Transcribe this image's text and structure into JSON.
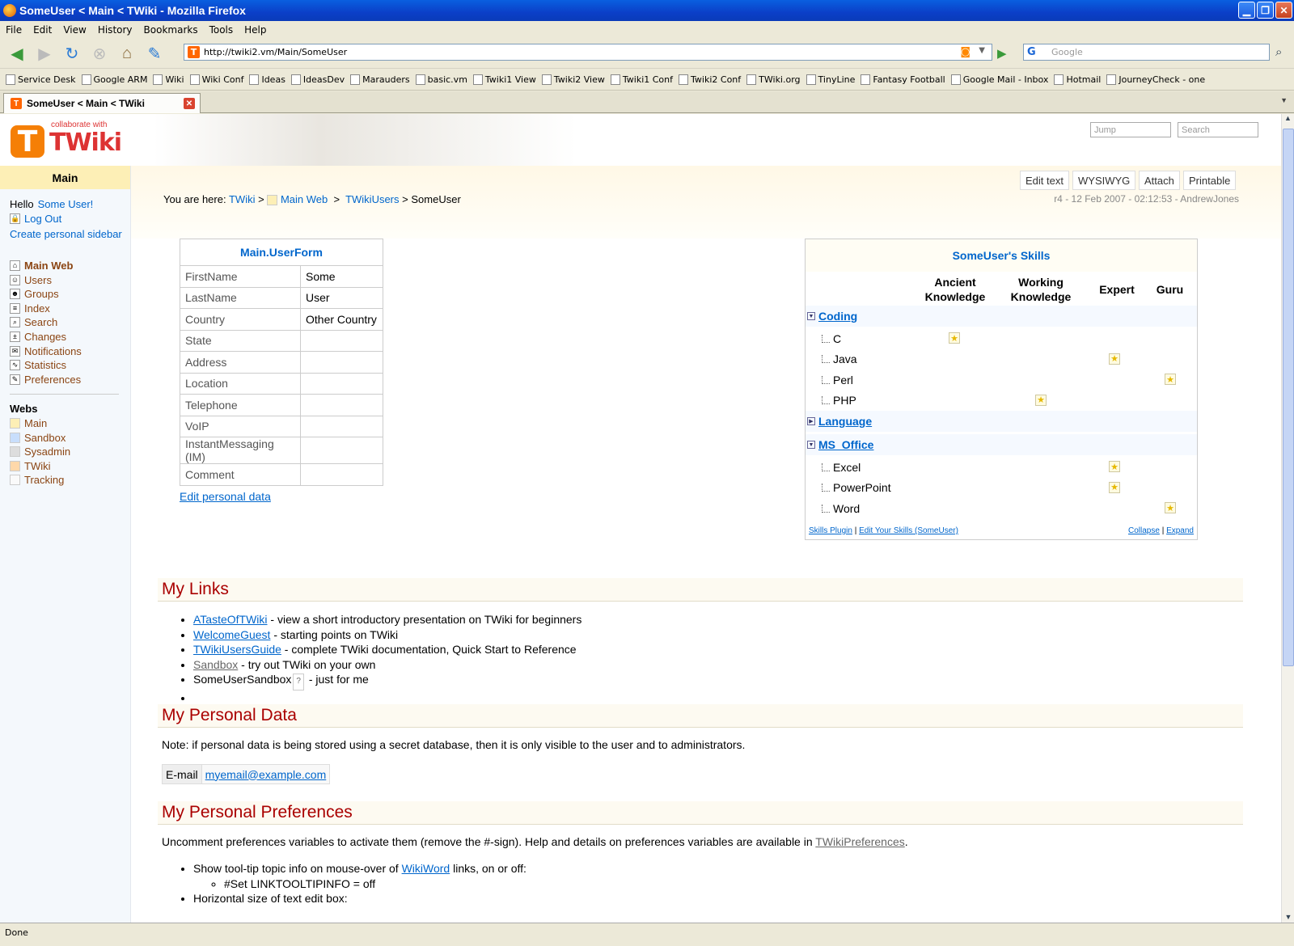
{
  "window": {
    "title": "SomeUser < Main < TWiki - Mozilla Firefox"
  },
  "menu": [
    "File",
    "Edit",
    "View",
    "History",
    "Bookmarks",
    "Tools",
    "Help"
  ],
  "nav": {
    "url": "http://twiki2.vm/Main/SomeUser",
    "search_placeholder": "Google"
  },
  "bookmarks": [
    "Service Desk",
    "Google ARM",
    "Wiki",
    "Wiki Conf",
    "Ideas",
    "IdeasDev",
    "Marauders",
    "basic.vm",
    "Twiki1 View",
    "Twiki2 View",
    "Twiki1 Conf",
    "Twiki2 Conf",
    "TWiki.org",
    "TinyLine",
    "Fantasy Football",
    "Google Mail - Inbox",
    "Hotmail",
    "JourneyCheck - one"
  ],
  "tab": {
    "label": "SomeUser < Main < TWiki"
  },
  "status": "Done",
  "header": {
    "tagline": "collaborate with",
    "brand": "TWiki",
    "jump_placeholder": "Jump",
    "search_placeholder": "Search"
  },
  "sidebar": {
    "web_title": "Main",
    "hello": "Hello",
    "user_link": "Some User!",
    "logout": "Log Out",
    "create_sidebar": "Create personal sidebar",
    "items": [
      "Main Web",
      "Users",
      "Groups",
      "Index",
      "Search",
      "Changes",
      "Notifications",
      "Statistics",
      "Preferences"
    ],
    "webs_title": "Webs",
    "webs": [
      {
        "name": "Main",
        "color": "#fdefb6"
      },
      {
        "name": "Sandbox",
        "color": "#c8defc"
      },
      {
        "name": "Sysadmin",
        "color": "#ddd"
      },
      {
        "name": "TWiki",
        "color": "#ffd8aa"
      },
      {
        "name": "Tracking",
        "color": "#fafafa"
      }
    ]
  },
  "toolbar": [
    "Edit text",
    "WYSIWYG",
    "Attach",
    "Printable"
  ],
  "breadcrumb": {
    "prefix": "You are here:",
    "c1": "TWiki",
    "sep": ">",
    "c2": "Main Web",
    "c3": "TWikiUsers",
    "current": "SomeUser"
  },
  "revision": "r4 - 12 Feb 2007 - 02:12:53 - AndrewJones",
  "userform": {
    "title": "Main.UserForm",
    "rows": [
      [
        "FirstName",
        "Some"
      ],
      [
        "LastName",
        "User"
      ],
      [
        "Country",
        "Other Country"
      ],
      [
        "State",
        ""
      ],
      [
        "Address",
        ""
      ],
      [
        "Location",
        ""
      ],
      [
        "Telephone",
        ""
      ],
      [
        "VoIP",
        ""
      ],
      [
        "InstantMessaging (IM)",
        ""
      ],
      [
        "Comment",
        ""
      ]
    ],
    "edit_link": "Edit personal data"
  },
  "skills": {
    "title": "SomeUser's Skills",
    "levels": [
      "Ancient Knowledge",
      "Working Knowledge",
      "Expert",
      "Guru"
    ],
    "categories": [
      {
        "name": "Coding",
        "expanded": true,
        "skills": [
          {
            "name": "C",
            "level": 0
          },
          {
            "name": "Java",
            "level": 2
          },
          {
            "name": "Perl",
            "level": 3
          },
          {
            "name": "PHP",
            "level": 1
          }
        ]
      },
      {
        "name": "Language",
        "expanded": false,
        "skills": []
      },
      {
        "name": "MS_Office",
        "expanded": true,
        "skills": [
          {
            "name": "Excel",
            "level": 2
          },
          {
            "name": "PowerPoint",
            "level": 2
          },
          {
            "name": "Word",
            "level": 3
          }
        ]
      }
    ],
    "footer_left": "Skills Plugin",
    "footer_left2": "Edit Your Skills (SomeUser)",
    "footer_right": "Collapse",
    "footer_right2": "Expand",
    "sep": "|"
  },
  "sections": {
    "links": "My Links",
    "personal": "My Personal Data",
    "prefs": "My Personal Preferences"
  },
  "links": [
    {
      "link": "ATasteOfTWiki",
      "text": " - view a short introductory presentation on TWiki for beginners"
    },
    {
      "link": "WelcomeGuest",
      "text": " - starting points on TWiki"
    },
    {
      "link": "TWikiUsersGuide",
      "text": " - complete TWiki documentation, Quick Start to Reference"
    },
    {
      "link": "Sandbox",
      "text": " - try out TWiki on your own"
    },
    {
      "plain": "SomeUserSandbox",
      "q": "?",
      "text": " - just for me"
    }
  ],
  "personal": {
    "note": "Note: if personal data is being stored using a secret database, then it is only visible to the user and to administrators.",
    "email_label": "E-mail",
    "email": "myemail@example.com"
  },
  "prefs": {
    "intro": "Uncomment preferences variables to activate them (remove the #-sign). Help and details on preferences variables are available in ",
    "intro_link": "TWikiPreferences",
    "intro_end": ".",
    "item1_pre": "Show tool-tip topic info on mouse-over of ",
    "item1_link": "WikiWord",
    "item1_post": " links, on or off:",
    "item1_sub": "#Set LINKTOOLTIPINFO = off",
    "item2": "Horizontal size of text edit box:"
  }
}
